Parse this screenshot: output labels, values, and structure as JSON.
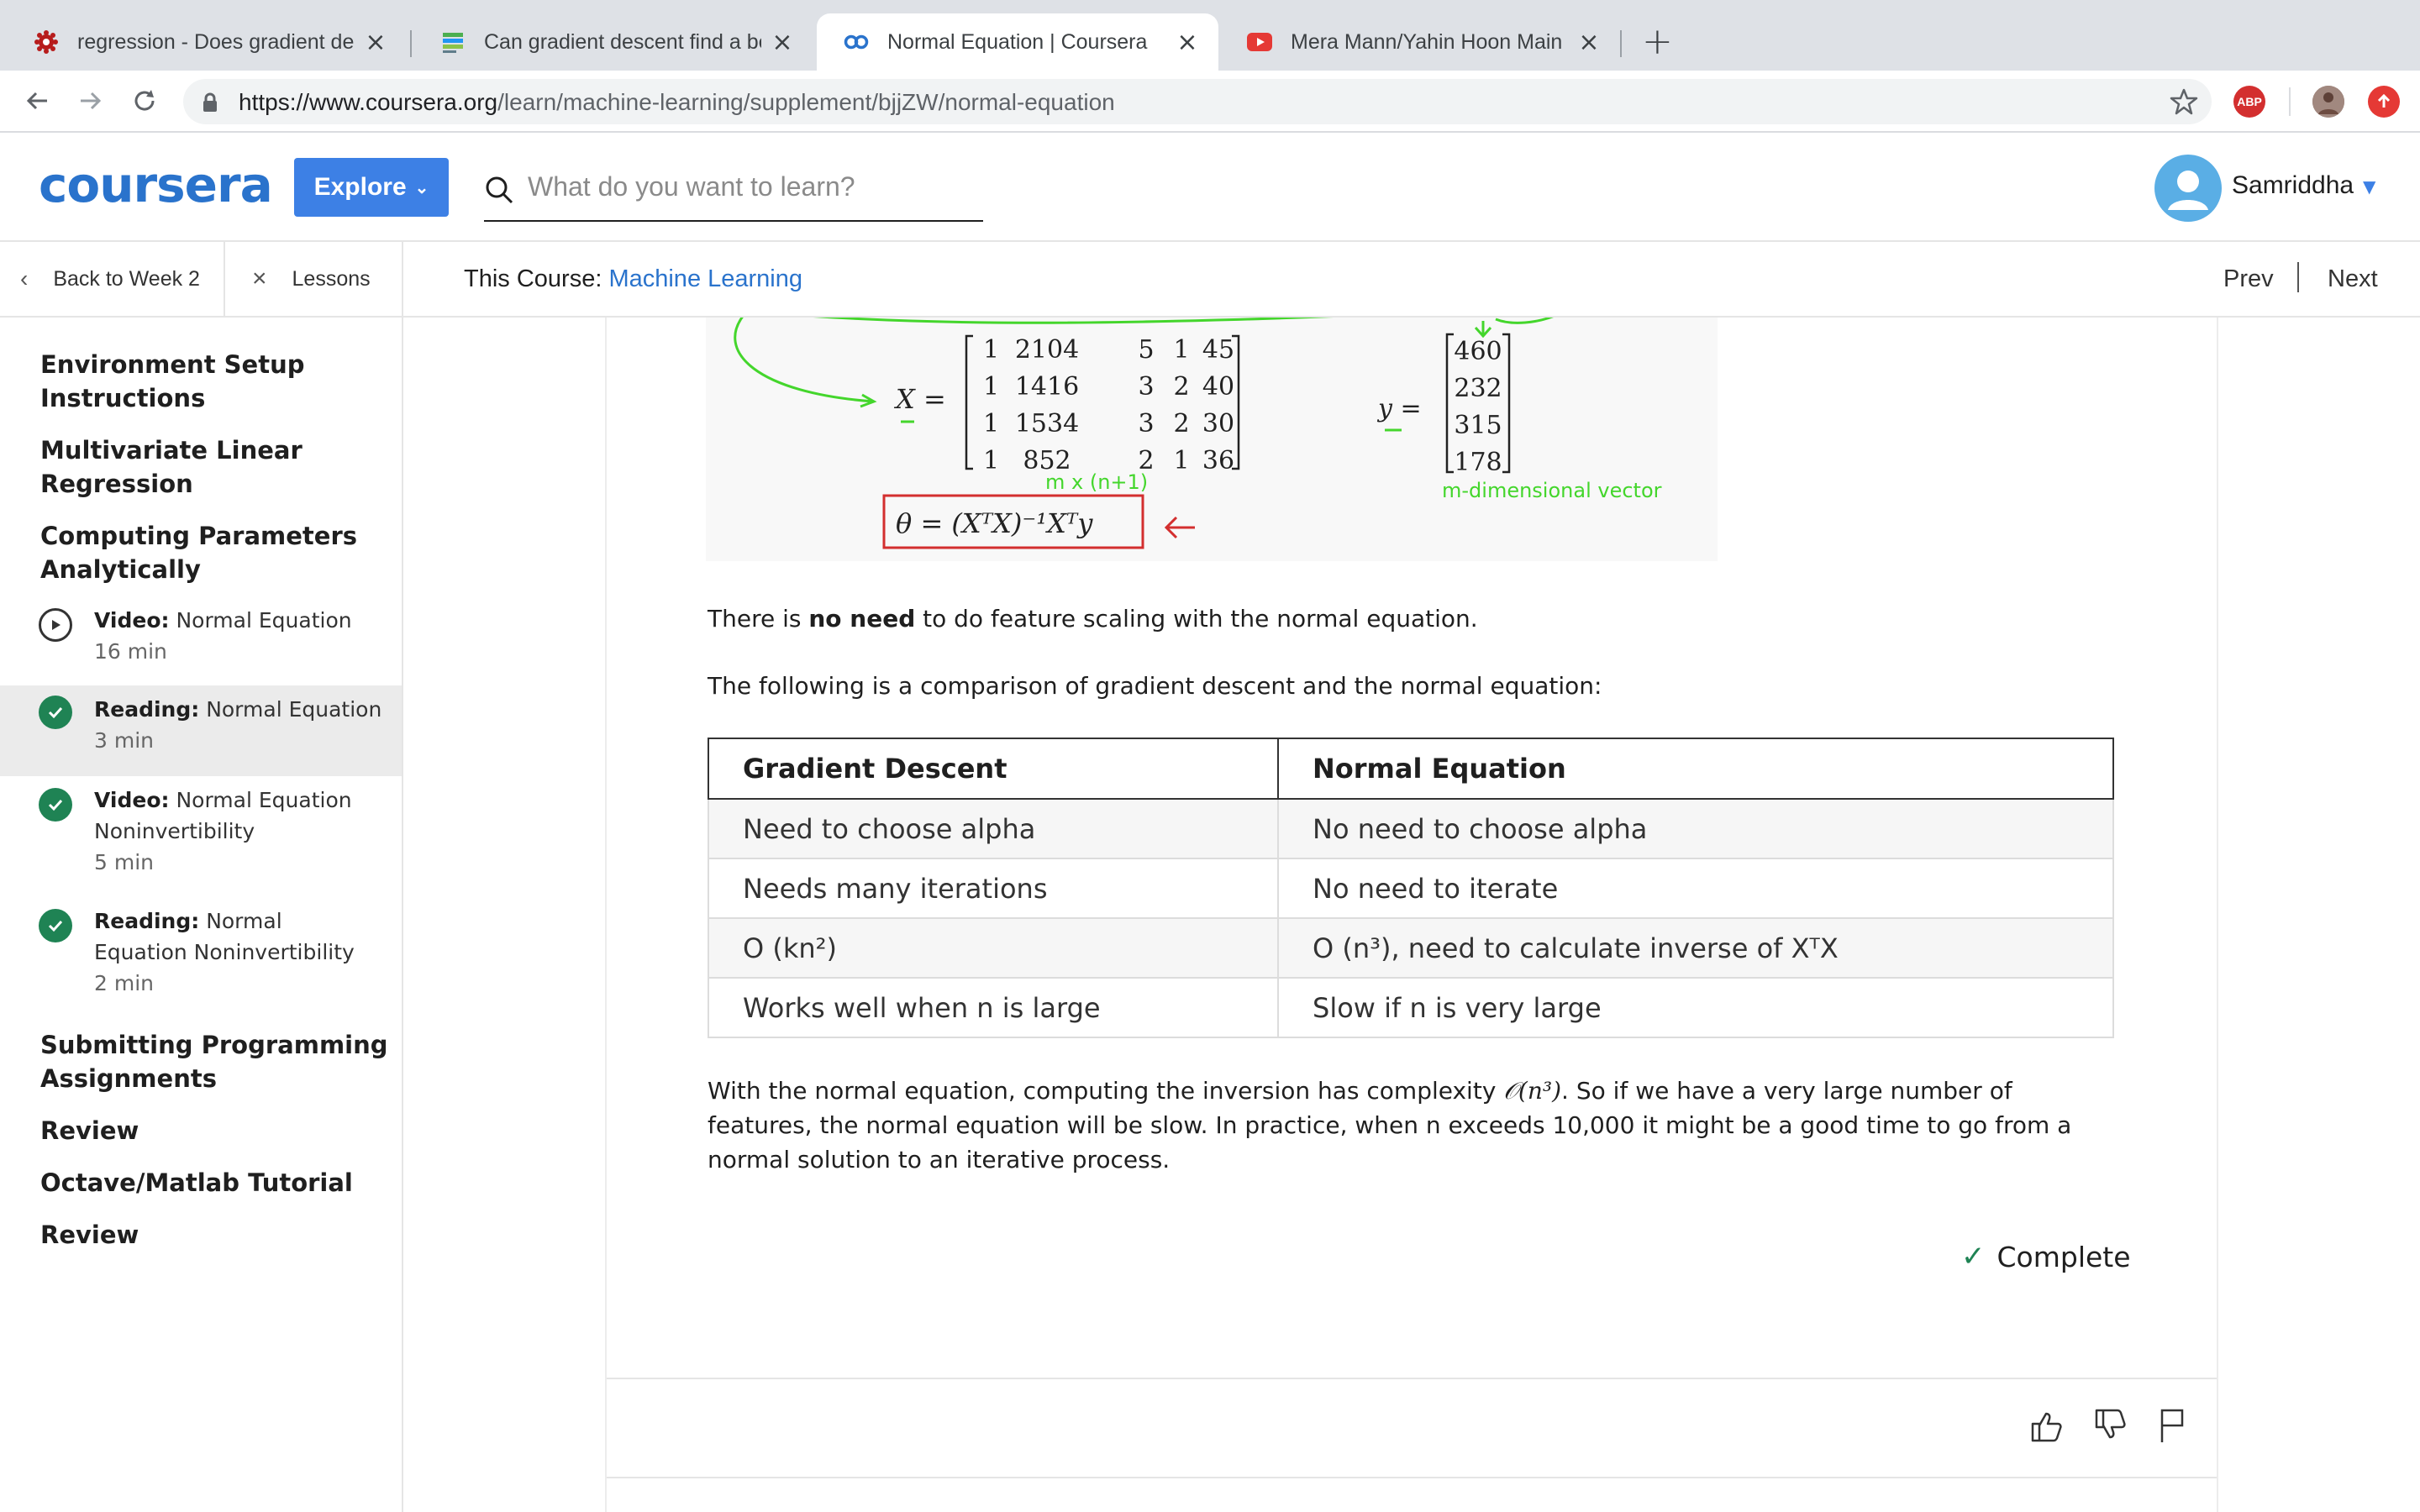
{
  "browser": {
    "tabs": [
      {
        "title": "regression - Does gradient descent",
        "active": false,
        "favicon": "stackexchange-favicon-icon"
      },
      {
        "title": "Can gradient descent find a better",
        "active": false,
        "favicon": "datascience-favicon-icon"
      },
      {
        "title": "Normal Equation | Coursera",
        "active": true,
        "favicon": "coursera-favicon-icon"
      },
      {
        "title": "Mera Mann/Yahin Hoon Main Sanam",
        "active": false,
        "favicon": "youtube-favicon-icon"
      }
    ],
    "url_host": "https://www.coursera.org",
    "url_path": "/learn/machine-learning/supplement/bjjZW/normal-equation",
    "extensions": [
      {
        "name": "adblock-plus-icon",
        "label": "ABP",
        "color": "#d32f2f"
      },
      {
        "name": "profile-photo-icon",
        "color": "#8d6e63"
      },
      {
        "name": "update-icon",
        "color": "#e53935"
      }
    ]
  },
  "header": {
    "logo": "coursera",
    "explore_label": "Explore",
    "search_placeholder": "What do you want to learn?",
    "user_name": "Samriddha",
    "accent": "#2a73cc"
  },
  "subnav": {
    "back_label": "Back to Week 2",
    "lessons_label": "Lessons",
    "course_prefix": "This Course:",
    "course_name": "Machine Learning",
    "prev_label": "Prev",
    "next_label": "Next"
  },
  "sidebar": {
    "sections": [
      {
        "label": "Environment Setup Instructions"
      },
      {
        "label": "Multivariate Linear Regression"
      },
      {
        "label": "Computing Parameters Analytically"
      },
      {
        "label": "Submitting Programming Assignments"
      },
      {
        "label": "Review"
      },
      {
        "label": "Octave/Matlab Tutorial"
      },
      {
        "label": "Review"
      }
    ],
    "items": [
      {
        "kind": "Video:",
        "title": "Normal Equation",
        "duration": "16 min",
        "status": "play"
      },
      {
        "kind": "Reading:",
        "title": "Normal Equation",
        "duration": "3 min",
        "status": "done",
        "selected": true
      },
      {
        "kind": "Video:",
        "title": "Normal Equation Noninvertibility",
        "duration": "5 min",
        "status": "done"
      },
      {
        "kind": "Reading:",
        "title": "Normal Equation Noninvertibility",
        "duration": "2 min",
        "status": "done"
      }
    ]
  },
  "content": {
    "math_image": {
      "x_label": "X =",
      "x_matrix": [
        [
          "1",
          "2104",
          "5",
          "1",
          "45"
        ],
        [
          "1",
          "1416",
          "3",
          "2",
          "40"
        ],
        [
          "1",
          "1534",
          "3",
          "2",
          "30"
        ],
        [
          "1",
          "852",
          "2",
          "1",
          "36"
        ]
      ],
      "x_dims": "m x (n+1)",
      "y_label": "y =",
      "y_vector": [
        "460",
        "232",
        "315",
        "178"
      ],
      "y_note": "m-dimensional vector",
      "theta_formula": "θ = (XᵀX)⁻¹Xᵀy"
    },
    "p1_before": "There is ",
    "p1_bold": "no need",
    "p1_after": " to do feature scaling with the normal equation.",
    "p2": "The following is a comparison of gradient descent and the normal equation:",
    "table": {
      "headers": [
        "Gradient Descent",
        "Normal Equation"
      ],
      "rows": [
        [
          "Need to choose alpha",
          "No need to choose alpha"
        ],
        [
          "Needs many iterations",
          "No need to iterate"
        ],
        [
          "O (kn²)",
          "O (n³), need to calculate inverse of XᵀX"
        ],
        [
          "Works well when n is large",
          "Slow if n is very large"
        ]
      ]
    },
    "p3_a": "With the normal equation, computing the inversion has complexity ",
    "p3_math": "𝒪(n³)",
    "p3_b": ". So if we have a very large number of features, the normal equation will be slow. In practice, when n exceeds 10,000 it might be a good time to go from a normal solution to an iterative process.",
    "complete_label": "Complete"
  }
}
